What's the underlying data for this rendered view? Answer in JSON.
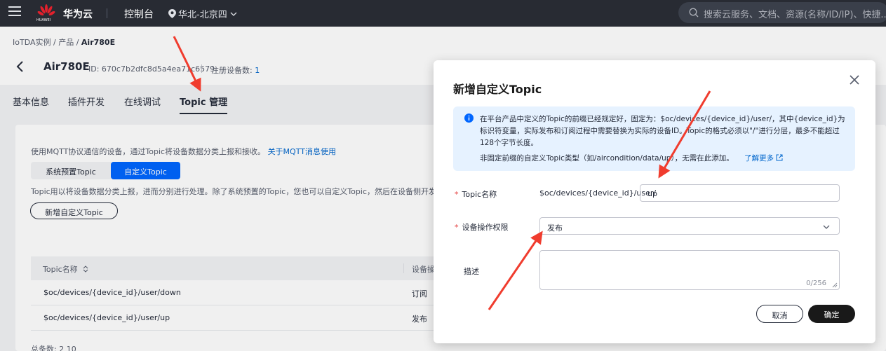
{
  "topnav": {
    "logo_text": "HUAWEI",
    "brand": "华为云",
    "console": "控制台",
    "region": "华北-北京四",
    "search_placeholder": "搜索云服务、文档、资源(名称/ID/IP)、快捷..."
  },
  "breadcrumb": [
    "IoTDA实例",
    "产品",
    "Air780E"
  ],
  "device": {
    "name": "Air780E",
    "id": "ID: 670c7b2dfc8d5a4ea71c6579",
    "reg_label": "注册设备数:",
    "reg_count": "1"
  },
  "tabs": [
    "基本信息",
    "插件开发",
    "在线调试",
    "Topic 管理"
  ],
  "content": {
    "desc1": "使用MQTT协议通信的设备，通过Topic将设备数据分类上报和接收。",
    "desc1_link": "关于MQTT消息使用",
    "seg1": "系统预置Topic",
    "seg2": "自定义Topic",
    "desc2": "Topic用以将设备数据分类上报，进而分别进行处理。除了系统预置的Topic，您也可以自定义Topic，然后在设备侧开发时",
    "add_button": "新增自定义Topic",
    "col1": "Topic名称",
    "col2": "设备操",
    "rows": [
      {
        "topic": "$oc/devices/{device_id}/user/down",
        "perm": "订阅"
      },
      {
        "topic": "$oc/devices/{device_id}/user/up",
        "perm": "发布"
      }
    ],
    "pager": "总条数: 2     10"
  },
  "modal": {
    "title": "新增自定义Topic",
    "info1": "在平台产品中定义的Topic的前缀已经规定好，固定为：$oc/devices/{device_id}/user/，其中{device_id}为标识符变量，实际发布和订阅过程中需要替换为实际的设备ID。Topic的格式必须以\"/\"进行分层，最多不能超过128个字节长度。",
    "info2": "非固定前缀的自定义Topic类型（如/aircondition/data/up），无需在此添加。",
    "info2_link": "了解更多",
    "label_name": "Topic名称",
    "prefix": "$oc/devices/{device_id}/user/",
    "name_value": "up",
    "label_perm": "设备操作权限",
    "perm_value": "发布",
    "label_desc": "描述",
    "desc_count": "0/256",
    "cancel": "取消",
    "ok": "确定"
  },
  "colors": {
    "nav_bg": "#282b33",
    "primary": "#0066ff",
    "link": "#0066cc",
    "required": "#e54545",
    "info_bg": "#e6f2ff",
    "arrow": "#f03c2e"
  }
}
